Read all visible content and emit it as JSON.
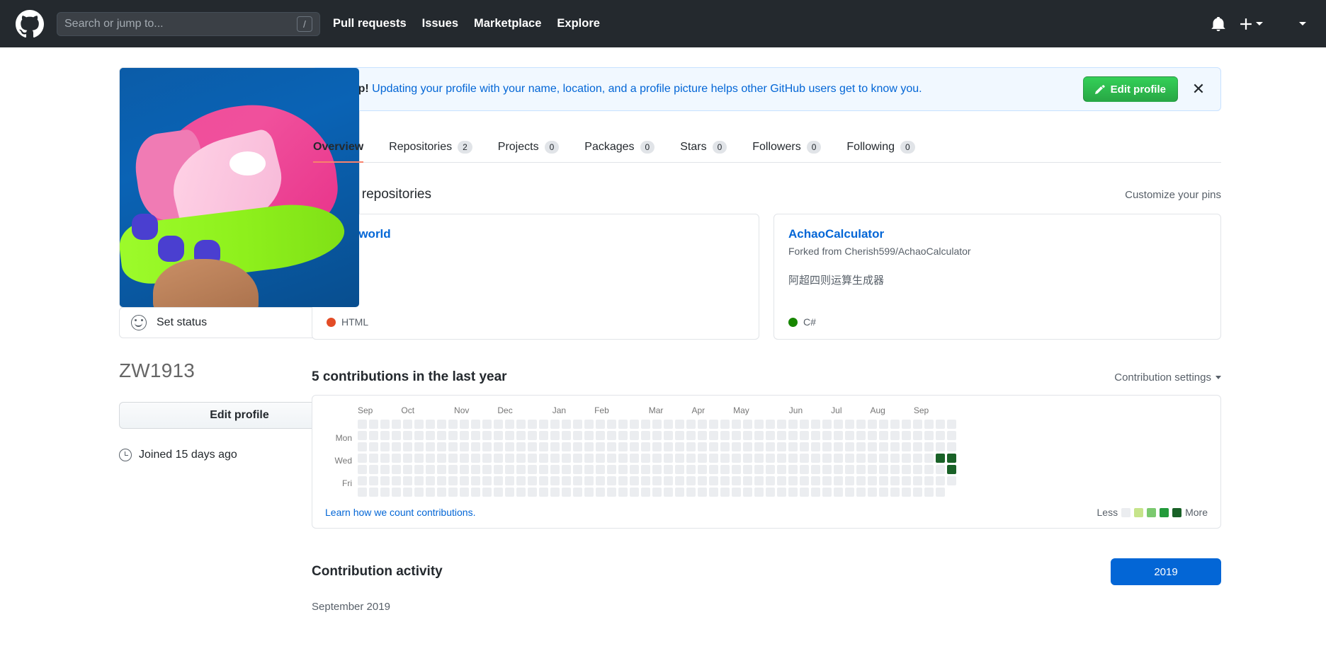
{
  "header": {
    "logo_icon": "github-mark-icon",
    "search": {
      "placeholder": "Search or jump to...",
      "value": "",
      "shortcut_key": "/"
    },
    "nav": [
      {
        "label": "Pull requests"
      },
      {
        "label": "Issues"
      },
      {
        "label": "Marketplace"
      },
      {
        "label": "Explore"
      }
    ],
    "notifications_icon": "bell-icon",
    "create_new_icon": "plus-icon",
    "avatar_icon": "user-avatar",
    "background_color": "#24292e"
  },
  "protip": {
    "label": "ProTip!",
    "message": " Updating your profile with your name, location, and a profile picture helps other GitHub users get to know you.",
    "edit_button": "Edit profile",
    "edit_icon": "pencil-icon",
    "close_icon": "close-icon",
    "background_color": "#f1f8ff",
    "border_color": "#c8e1ff"
  },
  "sidebar": {
    "avatar_alt": "profile-avatar-sneaker",
    "set_status": {
      "label": "Set status",
      "icon": "smiley-icon"
    },
    "username": "ZW1913",
    "edit_profile_button": "Edit profile",
    "joined": {
      "icon": "clock-icon",
      "text": "Joined 15 days ago"
    }
  },
  "tabs": [
    {
      "label": "Overview",
      "count": null,
      "active": true
    },
    {
      "label": "Repositories",
      "count": "2",
      "active": false
    },
    {
      "label": "Projects",
      "count": "0",
      "active": false
    },
    {
      "label": "Packages",
      "count": "0",
      "active": false
    },
    {
      "label": "Stars",
      "count": "0",
      "active": false
    },
    {
      "label": "Followers",
      "count": "0",
      "active": false
    },
    {
      "label": "Following",
      "count": "0",
      "active": false
    }
  ],
  "popular_repositories": {
    "title": "Popular repositories",
    "customize_link": "Customize your pins",
    "repos": [
      {
        "name": "hello-world",
        "forked_from": "",
        "description": "",
        "language": "HTML",
        "language_color": "#e34c26"
      },
      {
        "name": "AchaoCalculator",
        "forked_from": "Forked from Cherish599/AchaoCalculator",
        "description": "阿超四则运算生成器",
        "language": "C#",
        "language_color": "#178600"
      }
    ]
  },
  "contributions": {
    "title": "5 contributions in the last year",
    "settings_label": "Contribution settings",
    "learn_link": "Learn how we count contributions.",
    "legend_less": "Less",
    "legend_more": "More",
    "legend_colors": [
      "#ebedf0",
      "#c6e48b",
      "#7bc96f",
      "#239a3b",
      "#196127"
    ],
    "day_labels": [
      "Mon",
      "Wed",
      "Fri"
    ],
    "month_labels": [
      "Sep",
      "Oct",
      "Nov",
      "Dec",
      "Jan",
      "Feb",
      "Mar",
      "Apr",
      "May",
      "Jun",
      "Jul",
      "Aug",
      "Sep"
    ],
    "weeks": 53,
    "days_per_week": 7,
    "empty_color": "#ebedf0",
    "active_cells": [
      {
        "week": 51,
        "day": 3,
        "level": 4
      },
      {
        "week": 52,
        "day": 3,
        "level": 4
      },
      {
        "week": 52,
        "day": 4,
        "level": 4
      }
    ],
    "last_week_days": 6
  },
  "contribution_activity": {
    "title": "Contribution activity",
    "year_button": "2019",
    "month": "September 2019"
  }
}
